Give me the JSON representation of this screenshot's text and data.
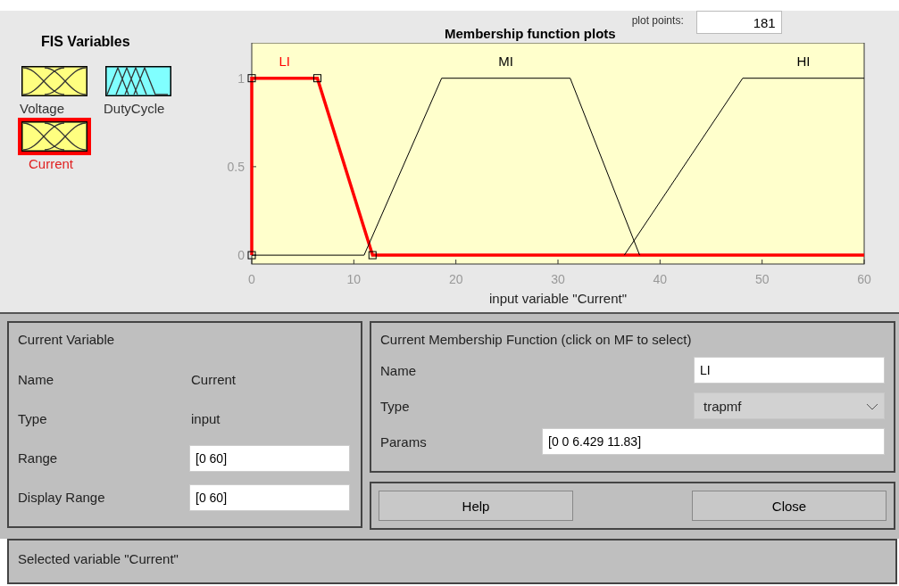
{
  "fis_variables": {
    "title": "FIS Variables",
    "items": [
      {
        "name": "Voltage",
        "kind": "input",
        "selected": false
      },
      {
        "name": "DutyCycle",
        "kind": "output",
        "selected": false
      },
      {
        "name": "Current",
        "kind": "input",
        "selected": true
      }
    ]
  },
  "plot": {
    "title": "Membership function plots",
    "plot_points_label": "plot points:",
    "plot_points": "181",
    "chart_data": {
      "type": "line",
      "xlabel": "input variable \"Current\"",
      "xlim": [
        0,
        60
      ],
      "ylim": [
        -0.05,
        1.2
      ],
      "xticks": [
        0,
        10,
        20,
        30,
        40,
        50,
        60
      ],
      "yticks": [
        0,
        0.5,
        1
      ],
      "series": [
        {
          "name": "LI",
          "color": "#ff0000",
          "x": [
            0,
            0,
            6.429,
            11.83,
            60
          ],
          "values": [
            0,
            1,
            1,
            0,
            0
          ]
        },
        {
          "name": "MI",
          "color": "#000000",
          "x": [
            0,
            11,
            18.6,
            31.2,
            38
          ],
          "values": [
            0,
            0,
            1,
            1,
            0
          ]
        },
        {
          "name": "HI",
          "color": "#000000",
          "x": [
            36.5,
            48.1,
            60
          ],
          "values": [
            0,
            1,
            1
          ]
        }
      ]
    }
  },
  "current_variable": {
    "title": "Current Variable",
    "name_label": "Name",
    "name": "Current",
    "type_label": "Type",
    "type": "input",
    "range_label": "Range",
    "range": "[0 60]",
    "display_range_label": "Display Range",
    "display_range": "[0 60]"
  },
  "membership_function": {
    "title": "Current Membership Function (click on MF to select)",
    "name_label": "Name",
    "name": "LI",
    "type_label": "Type",
    "type": "trapmf",
    "params_label": "Params",
    "params": "[0 0 6.429 11.83]"
  },
  "buttons": [
    "Help",
    "Close"
  ],
  "status_bar": "Selected variable \"Current\""
}
